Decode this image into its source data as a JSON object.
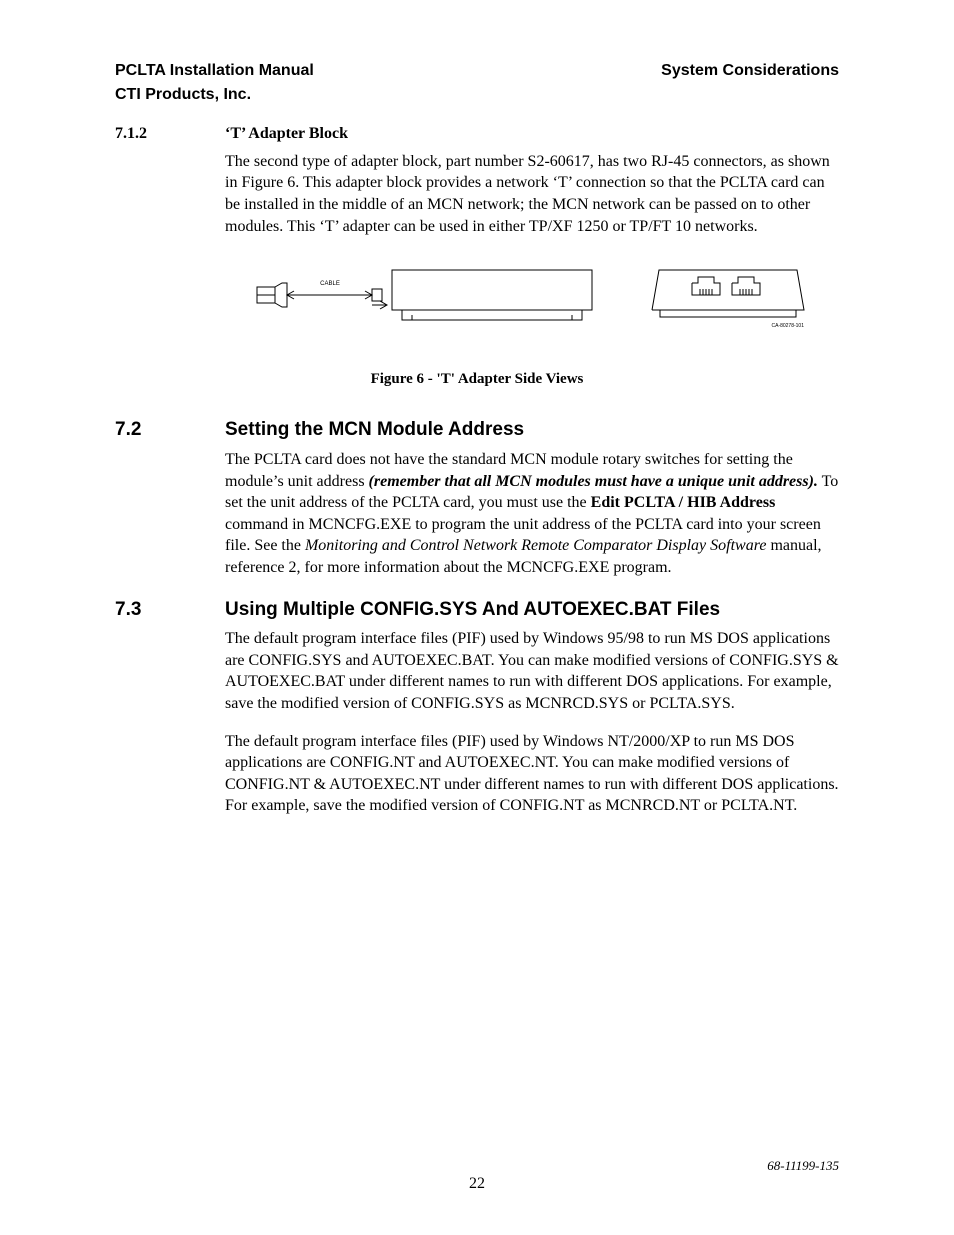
{
  "header": {
    "left1": "PCLTA Installation Manual",
    "right1": "System Considerations",
    "left2": "CTI Products, Inc."
  },
  "s712": {
    "num": "7.1.2",
    "title": "‘T’ Adapter Block",
    "para": "The second type of adapter block, part number S2-60617, has two RJ-45 connectors, as shown in Figure 6.  This adapter block provides a network ‘T’ connection so that the PCLTA card can be installed in the middle of an MCN network; the MCN network can be passed on to other modules.  This ‘T’ adapter can be used in either TP/XF 1250 or TP/FT 10 networks."
  },
  "figure": {
    "cable_label": "CABLE",
    "part_label": "CA-80278-101",
    "caption": "Figure 6 - 'T' Adapter Side Views"
  },
  "s72": {
    "num": "7.2",
    "title": "Setting the MCN Module Address",
    "para_pre": "The PCLTA card does not have the standard MCN module rotary switches for setting the module’s unit address ",
    "para_emph1": "(remember that all MCN modules must have a unique unit address).",
    "para_mid1": "  To set the unit address of the PCLTA card, you must use the ",
    "para_bold1": "Edit PCLTA / HIB Address",
    "para_mid2": " command in MCNCFG.EXE to program the unit address of the PCLTA card into your screen file.  See  the ",
    "para_ital1": "Monitoring and Control Network Remote Comparator Display Software",
    "para_post": " manual, reference 2, for more information about the MCNCFG.EXE program."
  },
  "s73": {
    "num": "7.3",
    "title": "Using Multiple CONFIG.SYS And AUTOEXEC.BAT Files",
    "para1": "The default program interface files (PIF) used by Windows 95/98 to run MS DOS applications are CONFIG.SYS and AUTOEXEC.BAT.  You can make modified versions of CONFIG.SYS & AUTOEXEC.BAT under different names to run with different DOS applications.  For example, save the modified version of CONFIG.SYS as MCNRCD.SYS or PCLTA.SYS.",
    "para2": "The default program interface files (PIF) used by Windows NT/2000/XP to run MS DOS applications are CONFIG.NT and AUTOEXEC.NT.  You can make modified versions of CONFIG.NT & AUTOEXEC.NT under different names to run with different DOS applications.  For example, save the modified version of CONFIG.NT as MCNRCD.NT or PCLTA.NT."
  },
  "footer": {
    "page": "22",
    "docnum": "68-11199-135"
  }
}
